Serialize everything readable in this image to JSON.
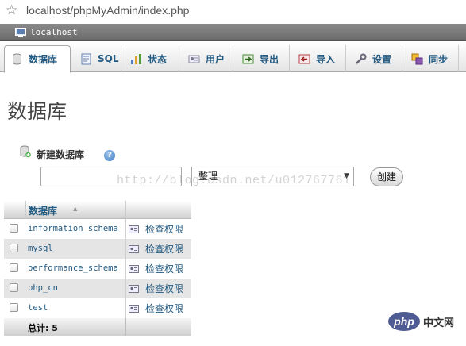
{
  "browser": {
    "url": "localhost/phpMyAdmin/index.php"
  },
  "server": {
    "label": "localhost"
  },
  "tabs": [
    {
      "label": "数据库",
      "icon": "database-icon",
      "active": true
    },
    {
      "label": "SQL",
      "icon": "sql-icon"
    },
    {
      "label": "状态",
      "icon": "status-icon"
    },
    {
      "label": "用户",
      "icon": "users-icon"
    },
    {
      "label": "导出",
      "icon": "export-icon"
    },
    {
      "label": "导入",
      "icon": "import-icon"
    },
    {
      "label": "设置",
      "icon": "settings-icon"
    },
    {
      "label": "同步",
      "icon": "sync-icon"
    }
  ],
  "page": {
    "title": "数据库"
  },
  "new_db": {
    "label": "新建数据库",
    "name_value": "",
    "collation_value": "整理",
    "create_label": "创建",
    "help_glyph": "?"
  },
  "watermark": "http://blog.csdn.net/u012767761",
  "table": {
    "header": "数据库",
    "rows": [
      {
        "name": "information_schema",
        "priv": "检查权限"
      },
      {
        "name": "mysql",
        "priv": "检查权限"
      },
      {
        "name": "performance_schema",
        "priv": "检查权限"
      },
      {
        "name": "php_cn",
        "priv": "检查权限"
      },
      {
        "name": "test",
        "priv": "检查权限"
      }
    ],
    "total": "总计: 5"
  },
  "logo": {
    "php": "php",
    "cn": "中文网"
  },
  "colors": {
    "link": "#235a81",
    "serverbar": "#7a7a7a",
    "php_logo": "#4f5b93"
  }
}
